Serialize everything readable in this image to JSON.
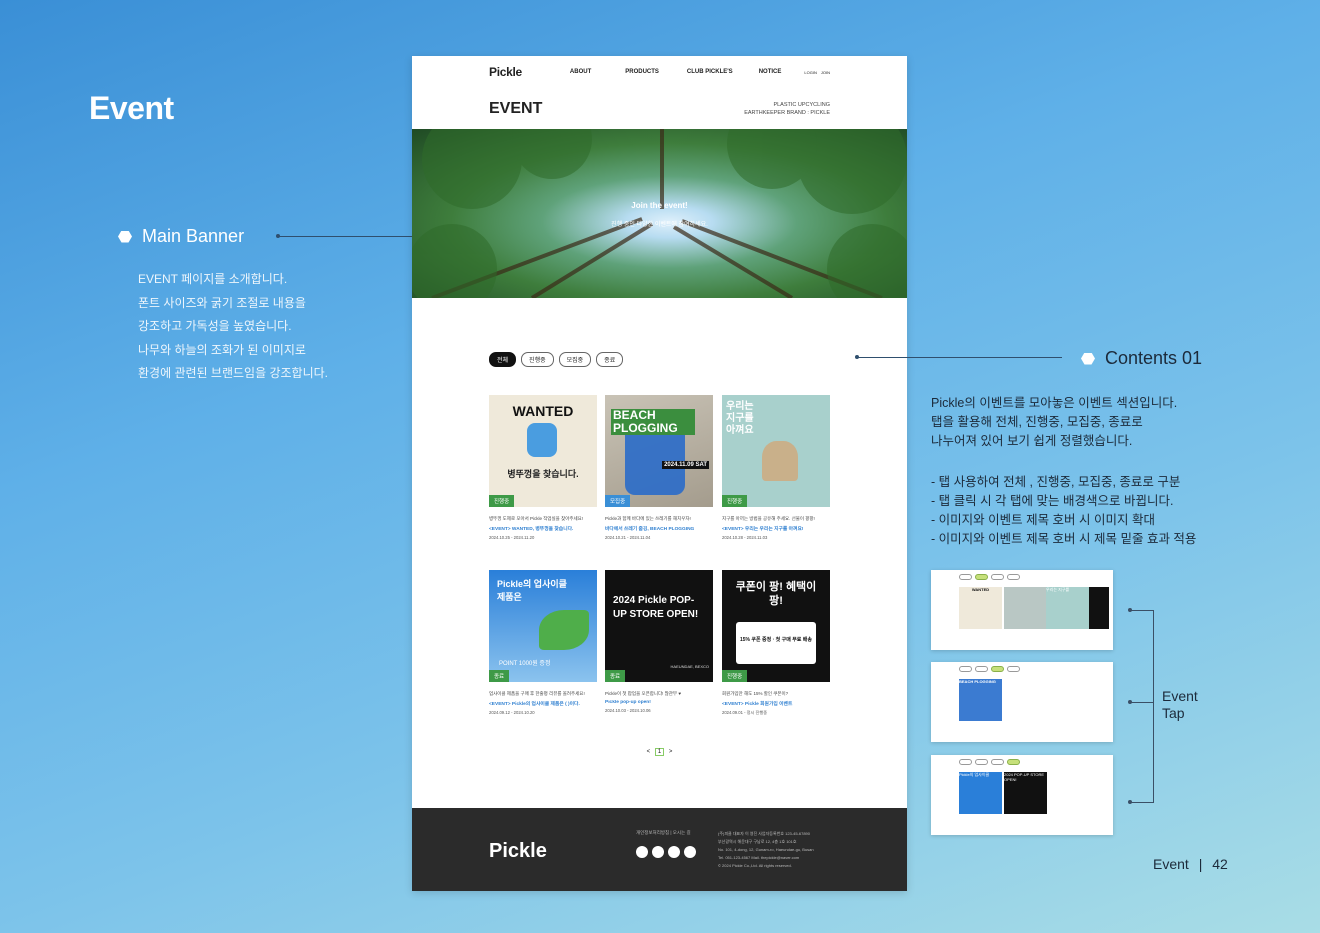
{
  "page": {
    "title": "Event"
  },
  "main_banner": {
    "heading": "Main Banner",
    "lines": [
      "EVENT 페이지를 소개합니다.",
      "폰트 사이즈와 굵기 조절로 내용을",
      "강조하고 가독성을 높였습니다.",
      "나무와 하늘의 조화가 된 이미지로",
      "환경에 관련된 브랜드임을 강조합니다."
    ]
  },
  "contents": {
    "heading": "Contents 01",
    "intro": [
      "Pickle의 이벤트를 모아놓은 이벤트 섹션입니다.",
      "탭을 활용해 전체, 진행중, 모집중, 종료로",
      "나누어져 있어 보기 쉽게 정렬했습니다."
    ],
    "bullets": [
      "- 탭 사용하여 전체 , 진행중, 모집중, 종료로 구분",
      "- 탭 클릭 시 각 탭에 맞는 배경색으로 바뀝니다.",
      "- 이미지와 이벤트 제목 호버 시 이미지 확대",
      "- 이미지와 이벤트 제목 호버 시 제목 밑줄 효과 적용"
    ]
  },
  "event_tap": {
    "line1": "Event",
    "line2": "Tap"
  },
  "footer_meta": {
    "section": "Event",
    "sep": "|",
    "page_number": "42"
  },
  "mock": {
    "logo": "Pickle",
    "nav": [
      "ABOUT",
      "PRODUCTS",
      "CLUB PICKLE'S",
      "NOTICE"
    ],
    "login": "LOGIN",
    "join": "JOIN",
    "event_title": "EVENT",
    "brand_line1": "PLASTIC UPCYCLING",
    "brand_line2": "EARTHKEEPER BRAND : PICKLE",
    "banner_title": "Join the event!",
    "banner_sub": "진행 중인 다양한 이벤트에 참여하세요.",
    "tabs": [
      "전체",
      "진행중",
      "모집중",
      "종료"
    ],
    "cards": [
      {
        "thumb": "WANTED",
        "sub": "병뚜껑을 찾습니다.",
        "badge": "진행중",
        "line": "병뚜껑 도제로 모아서 Pickle 작업실을 찾아주세요!",
        "title": "<EVENT> WANTED, 병뚜껑을 찾습니다.",
        "date": "2024.10.25 - 2024.11.20"
      },
      {
        "thumb": "BEACH PLOGGING",
        "sub": "2024.11.09 SAT",
        "badge": "모집중",
        "line": "Pickle과 함께 바다에 있는 쓰레기를 해치우자!",
        "title": "바다에서 쓰레기 줍깅, BEACH PLOGGING",
        "date": "2024.10.21 - 2024.11.04"
      },
      {
        "thumb": "우리는 지구를 아껴요",
        "sub": "",
        "badge": "진행중",
        "line": "지구를 아끼는 방법을 공유해 주세요. 선물이 팡팡!",
        "title": "<EVENT> 우리는 우리는 지구를 아껴요!",
        "date": "2024.10.28 - 2024.11.03"
      },
      {
        "thumb": "Pickle의 업사이클 제품은",
        "sub": "POINT 1000원 증정",
        "badge": "종료",
        "line": "업사이클 제품을 구매 후 한줄평 리뷰를 올려주세요!",
        "title": "<EVENT> Pickle의 업사이클 제품은 (   )이다.",
        "date": "2024.09.12 - 2024.10.20"
      },
      {
        "thumb": "2024 Pickle POP-UP STORE OPEN!",
        "sub": "HAEUNDAE, BEXCO",
        "badge": "종료",
        "line": "Pickle이 첫 팝업을 오픈합니다! 많관부 ♥",
        "title": "Pickle pop-up open!",
        "date": "2024.10.03 - 2024.10.06"
      },
      {
        "thumb": "쿠폰이 팡! 혜택이 팡!",
        "sub": "15% 쿠폰 증정 · 첫 구매 무료 배송",
        "badge": "진행중",
        "line": "회원가입만 해도 15% 할인 쿠폰이?",
        "title": "<EVENT> Pickle 회원가입 이벤트",
        "date": "2024.09.01 - 정시 진행중"
      }
    ],
    "pager": {
      "prev": "<",
      "current": "1",
      "next": ">"
    },
    "footer_logo": "Pickle",
    "footer_links": "개인정보처리방침  |  오시는 길",
    "footer_info": [
      "(주)피클   대표자 이 영진   사업자등록번호 123-45-67890",
      "부산광역시 해운대구 구남로 12, 4층 1호 101호",
      "No. 101, 4-dong, 12, Gunam-ro, Haeundae-gu, Busan",
      "Tel. 051-123-4567    Mail. thepickle@naver.com",
      "© 2024 Pickle Co.,Ltd. All rights reserved."
    ]
  },
  "previews": [
    {
      "labels": [
        "WANTED",
        "",
        "우리는 지구를"
      ]
    },
    {
      "labels": [
        "BEACH PLOGGING"
      ]
    },
    {
      "labels": [
        "Pickle의 업사이클",
        "2024 POP-UP STORE OPEN!"
      ]
    }
  ]
}
